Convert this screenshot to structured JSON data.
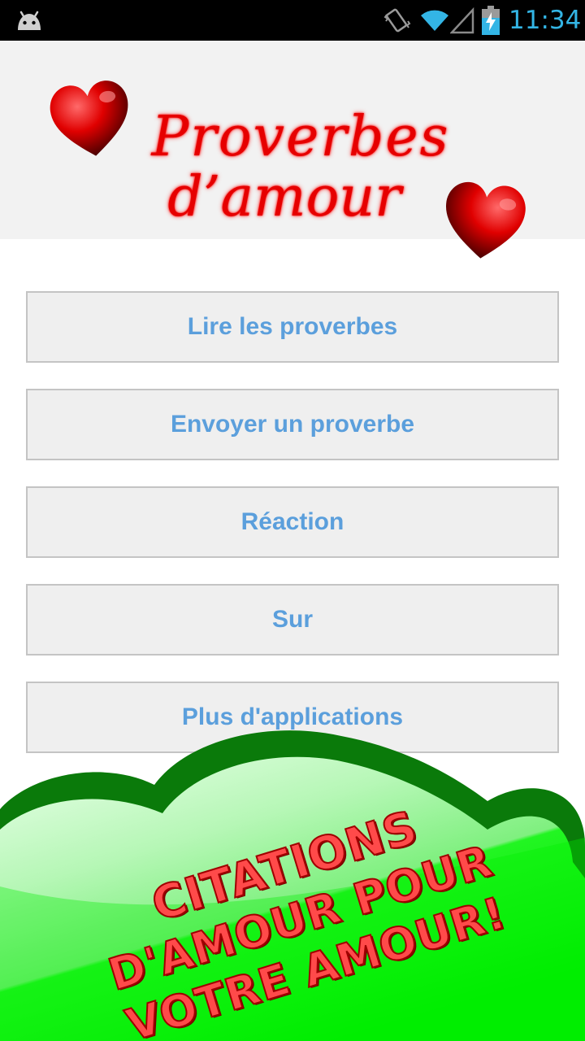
{
  "status_bar": {
    "time": "11:34",
    "icons": [
      "android-icon",
      "vibrate-icon",
      "wifi-icon",
      "signal-icon",
      "battery-charging-icon"
    ],
    "accent_color": "#33b5e5"
  },
  "header": {
    "title_line1": "Proverbes",
    "title_line2": "d’amour",
    "title_color": "#e60000",
    "decorations": [
      "heart-icon",
      "heart-icon"
    ]
  },
  "menu": {
    "items": [
      {
        "label": "Lire les proverbes"
      },
      {
        "label": "Envoyer un proverbe"
      },
      {
        "label": "Réaction"
      },
      {
        "label": "Sur"
      },
      {
        "label": "Plus d'applications"
      }
    ],
    "text_color": "#5b9fdc"
  },
  "promo": {
    "line1": "Citations",
    "line2": "d'amour pour",
    "line3": "votre amour!",
    "cloud_color": "#00ee00",
    "cloud_border_color": "#0a7a0a",
    "text_color": "#ff4a4a"
  }
}
